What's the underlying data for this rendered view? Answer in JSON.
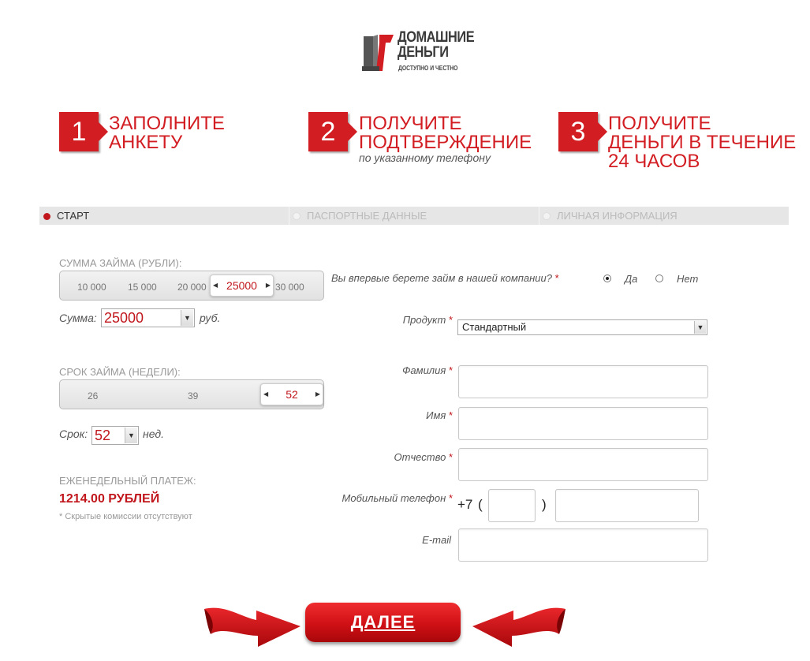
{
  "brand": {
    "name_line1": "ДОМАШНИЕ",
    "name_line2": "ДЕНЬГИ",
    "tagline": "ДОСТУПНО И ЧЕСТНО"
  },
  "steps": [
    {
      "number": "1",
      "title": "ЗАПОЛНИТЕ\nАНКЕТУ",
      "subtitle": ""
    },
    {
      "number": "2",
      "title": "ПОЛУЧИТЕ\nПОДТВЕРЖДЕНИЕ",
      "subtitle": "по указанному телефону"
    },
    {
      "number": "3",
      "title": "ПОЛУЧИТЕ\nДЕНЬГИ В ТЕЧЕНИЕ\n24 ЧАСОВ",
      "subtitle": ""
    }
  ],
  "progress": {
    "items": [
      {
        "label": "СТАРТ",
        "active": true
      },
      {
        "label": "ПАСПОРТНЫЕ ДАННЫЕ",
        "active": false
      },
      {
        "label": "ЛИЧНАЯ ИНФОРМАЦИЯ",
        "active": false
      }
    ]
  },
  "loan_amount": {
    "label": "СУММА ЗАЙМА (РУБЛИ):",
    "ticks": [
      "10 000",
      "15 000",
      "20 000",
      "30 000"
    ],
    "slider_value": "25000",
    "field_label": "Сумма:",
    "select_value": "25000",
    "unit": "руб."
  },
  "loan_term": {
    "label": "СРОК ЗАЙМА (НЕДЕЛИ):",
    "ticks": [
      "26",
      "39"
    ],
    "slider_value": "52",
    "field_label": "Срок:",
    "select_value": "52",
    "unit": "нед."
  },
  "weekly_payment": {
    "label": "ЕЖЕНЕДЕЛЬНЫЙ ПЛАТЕЖ:",
    "amount": "1214.00 РУБЛЕЙ",
    "note": "* Скрытые комиссии отсутствуют"
  },
  "form": {
    "first_time": {
      "question": "Вы впервые берете займ в нашей компании?",
      "yes": "Да",
      "no": "Нет",
      "selected": "yes"
    },
    "product": {
      "label": "Продукт",
      "value": "Стандартный"
    },
    "last_name": {
      "label": "Фамилия",
      "value": ""
    },
    "first_name": {
      "label": "Имя",
      "value": ""
    },
    "patronymic": {
      "label": "Отчество",
      "value": ""
    },
    "phone": {
      "label": "Мобильный телефон",
      "prefix": "+7",
      "open_paren": "(",
      "close_paren": ")",
      "code": "",
      "number": ""
    },
    "email": {
      "label": "E-mail",
      "value": ""
    },
    "required_mark": "*"
  },
  "next_button": {
    "label": "ДАЛЕЕ"
  },
  "colors": {
    "brand_red": "#d21d23",
    "progress_bg": "#e6e6e6"
  },
  "icons": [
    "logo-mark",
    "radio-selected-icon",
    "radio-empty-icon",
    "chevron-down-icon",
    "left-ribbon-arrow",
    "right-ribbon-arrow"
  ]
}
